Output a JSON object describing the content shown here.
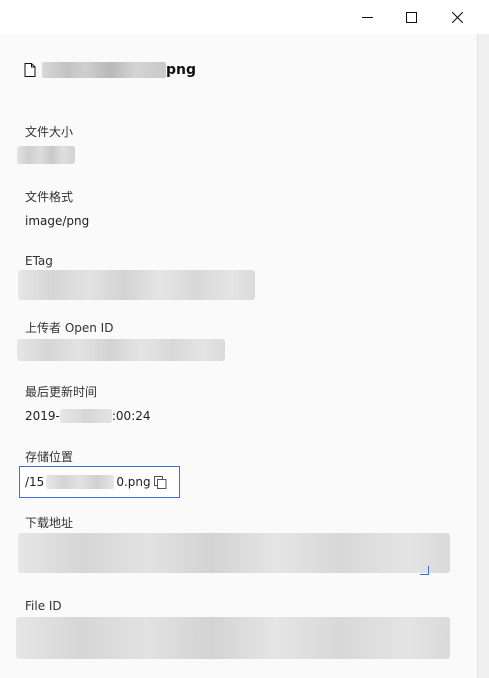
{
  "window": {
    "minimize_icon": "minimize-icon",
    "maximize_icon": "maximize-icon",
    "close_icon": "close-icon"
  },
  "file": {
    "icon": "file-icon",
    "name_suffix": "png"
  },
  "fields": {
    "size_label": "文件大小",
    "format_label": "文件格式",
    "format_value": "image/png",
    "etag_label": "ETag",
    "uploader_label": "上传者 Open ID",
    "updated_label": "最后更新时间",
    "updated_prefix": "2019-",
    "updated_suffix": ":00:24",
    "storage_label": "存储位置",
    "storage_prefix": "/15",
    "storage_suffix": "0.png",
    "download_label": "下载地址",
    "fileid_label": "File ID"
  },
  "colors": {
    "accent": "#3b6fd9"
  }
}
